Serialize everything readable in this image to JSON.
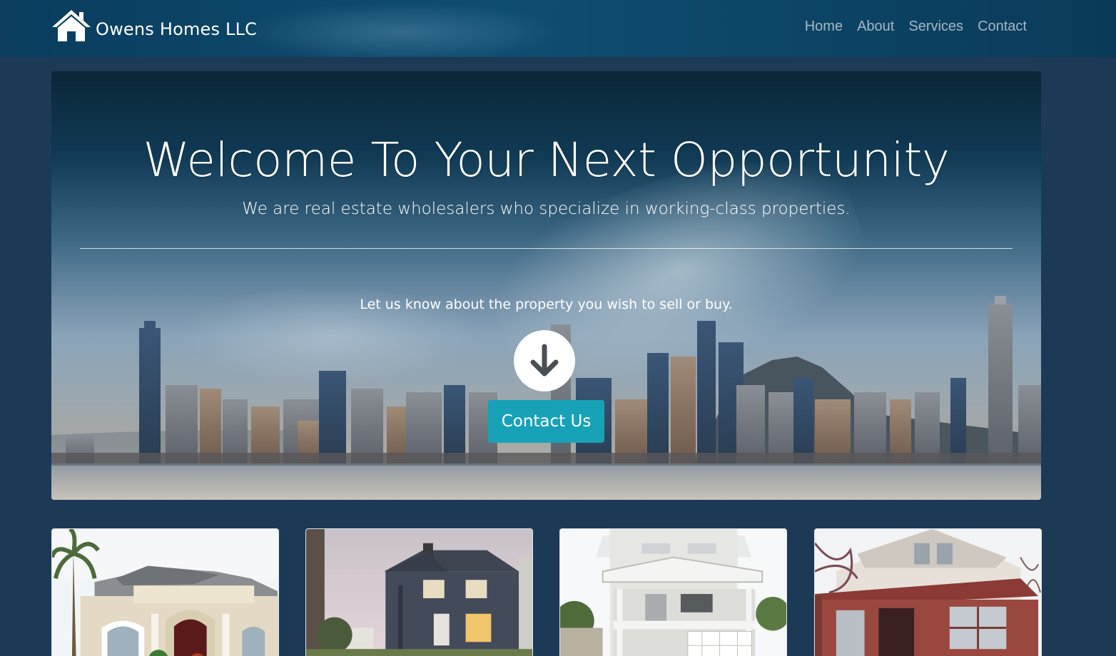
{
  "navbar": {
    "brand": "Owens Homes LLC",
    "brand_icon": "house-icon",
    "links": [
      {
        "label": "Home"
      },
      {
        "label": "About"
      },
      {
        "label": "Services"
      },
      {
        "label": "Contact"
      }
    ]
  },
  "hero": {
    "title": "Welcome To Your Next Opportunity",
    "subtitle": "We are real estate wholesalers who specialize in working-class properties.",
    "prompt": "Let us know about the property you wish to sell or buy.",
    "arrow_icon": "arrow-down-circle-icon",
    "contact_button": "Contact Us",
    "accent_color": "#17a2b8"
  },
  "properties": [
    {
      "image": "stucco-house-photo"
    },
    {
      "image": "dark-siding-house-photo"
    },
    {
      "image": "white-porch-house-photo"
    },
    {
      "image": "red-porch-house-photo"
    }
  ],
  "colors": {
    "page_background": "#1c3a56",
    "navbar_background": "#0f4d70",
    "button": "#17a2b8"
  }
}
